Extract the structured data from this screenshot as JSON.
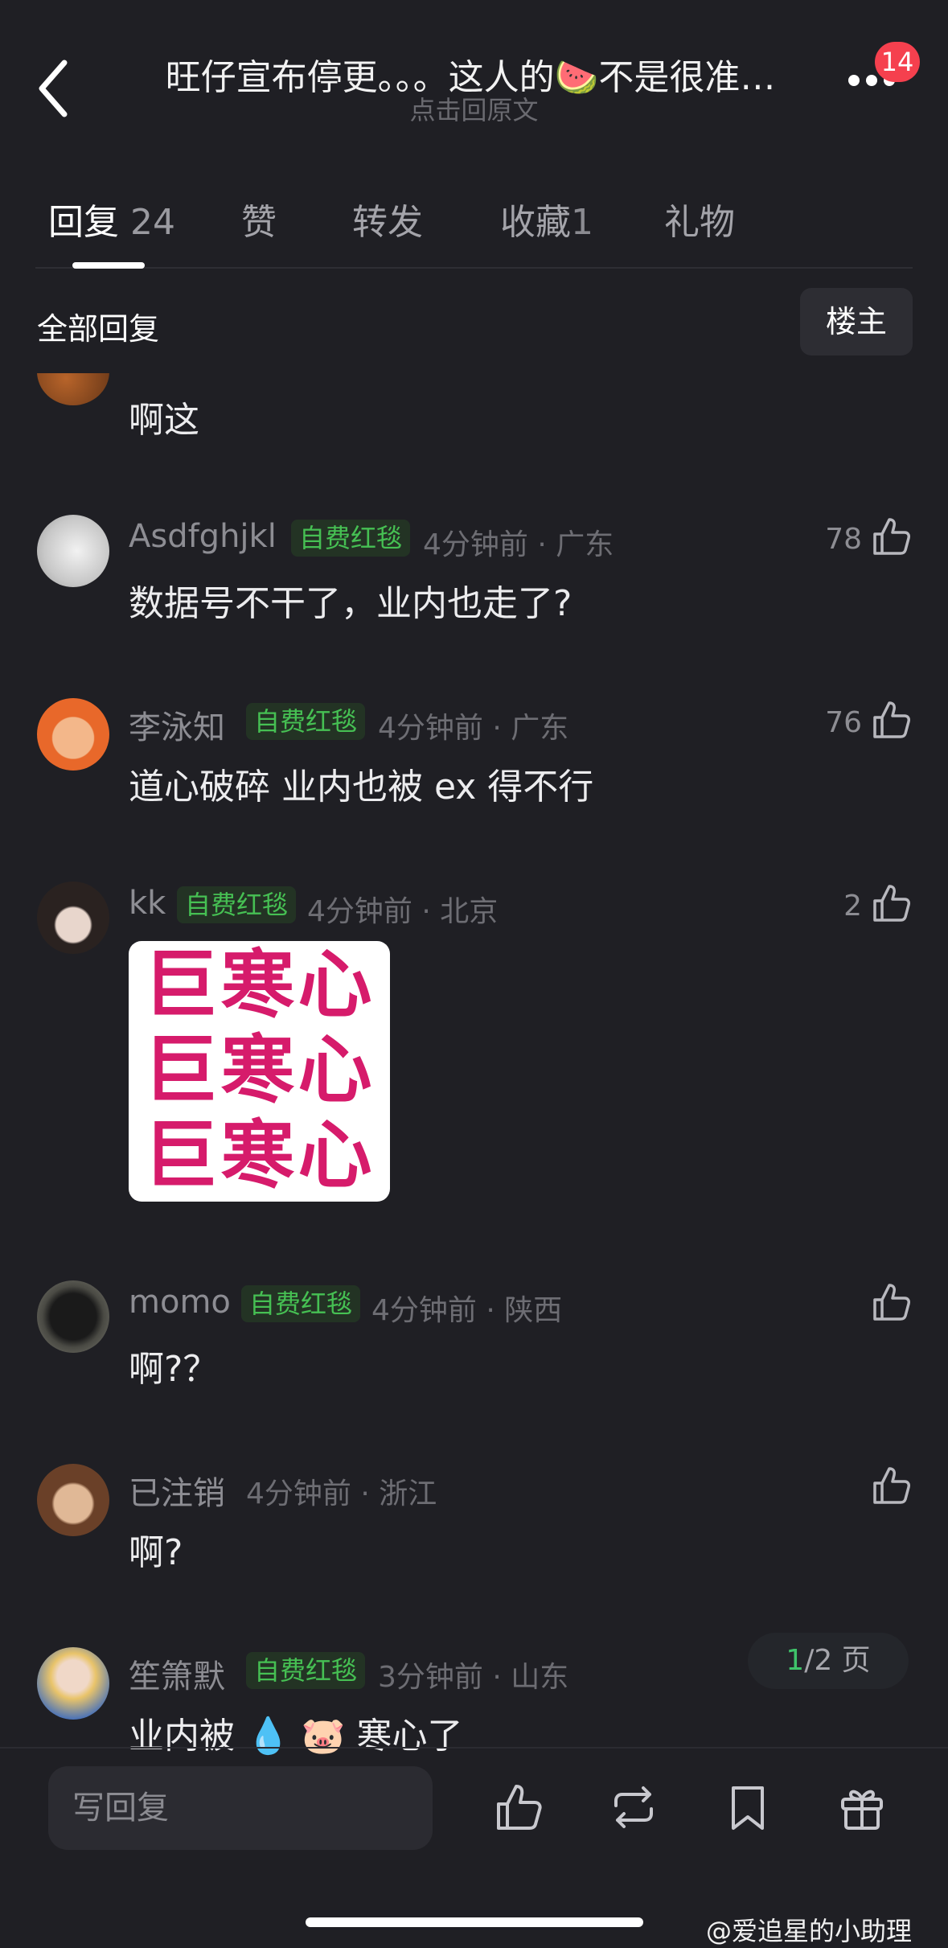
{
  "header": {
    "title": "旺仔宣布停更。。。这人的🍉不是很准…",
    "subtitle": "点击回原文",
    "notification_count": "14"
  },
  "tabs": [
    {
      "label": "回复",
      "count": "24",
      "active": true
    },
    {
      "label": "赞",
      "count": ""
    },
    {
      "label": "转发",
      "count": ""
    },
    {
      "label": "收藏",
      "count": "1"
    },
    {
      "label": "礼物",
      "count": ""
    }
  ],
  "sort": {
    "label": "全部回复",
    "filter_button": "楼主"
  },
  "comments": [
    {
      "username": "",
      "badge": "",
      "time": "",
      "location": "",
      "text": "啊这",
      "likes": ""
    },
    {
      "username": "Asdfghjkl",
      "badge": "自费红毯",
      "time": "4分钟前",
      "location": "广东",
      "text": "数据号不干了，业内也走了?",
      "likes": "78"
    },
    {
      "username": "李泳知",
      "badge": "自费红毯",
      "time": "4分钟前",
      "location": "广东",
      "text": "道心破碎 业内也被 ex 得不行",
      "likes": "76"
    },
    {
      "username": "kk",
      "badge": "自费红毯",
      "time": "4分钟前",
      "location": "北京",
      "text": "",
      "likes": "2",
      "sticker": [
        "巨寒心",
        "巨寒心",
        "巨寒心"
      ]
    },
    {
      "username": "momo",
      "badge": "自费红毯",
      "time": "4分钟前",
      "location": "陕西",
      "text": "啊?？",
      "likes": ""
    },
    {
      "username": "已注销",
      "badge": "",
      "time": "4分钟前",
      "location": "浙江",
      "text": "啊?",
      "likes": ""
    },
    {
      "username": "笙箫默",
      "badge": "自费红毯",
      "time": "3分钟前",
      "location": "山东",
      "text": "业内被 💧 🐷 寒心了",
      "likes": ""
    }
  ],
  "pager": {
    "current": "1",
    "total": "/2 页"
  },
  "bottom_bar": {
    "reply_placeholder": "写回复"
  },
  "watermark": "@爱追星的小助理",
  "colors": {
    "background": "#1f1f24",
    "badge_green": "#46c053",
    "sticker_pink": "#d61b6b",
    "notification_red": "#f5404e"
  }
}
